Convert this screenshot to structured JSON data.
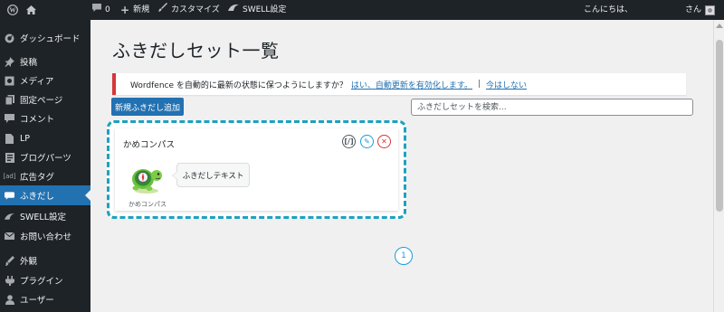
{
  "admin_bar": {
    "comments_count": "0",
    "new_label": "新規",
    "customize_label": "カスタマイズ",
    "swell_settings_label": "SWELL設定",
    "greeting": "こんにちは、",
    "greeting_suffix": "さん"
  },
  "sidebar": {
    "items": [
      {
        "label": "ダッシュボード",
        "icon": "dashboard-icon"
      },
      {
        "label": "投稿",
        "icon": "pin-icon"
      },
      {
        "label": "メディア",
        "icon": "media-icon"
      },
      {
        "label": "固定ページ",
        "icon": "page-icon"
      },
      {
        "label": "コメント",
        "icon": "comment-icon"
      },
      {
        "label": "LP",
        "icon": "lp-icon"
      },
      {
        "label": "ブログパーツ",
        "icon": "blog-parts-icon"
      },
      {
        "label": "広告タグ",
        "icon": "ad-tag-icon",
        "icon_text": "[ad]"
      },
      {
        "label": "ふきだし",
        "icon": "balloon-icon"
      },
      {
        "label": "SWELL設定",
        "icon": "swell-icon"
      },
      {
        "label": "お問い合わせ",
        "icon": "mail-icon"
      },
      {
        "label": "外観",
        "icon": "appearance-icon"
      },
      {
        "label": "プラグイン",
        "icon": "plugin-icon"
      },
      {
        "label": "ユーザー",
        "icon": "user-icon"
      }
    ]
  },
  "main": {
    "title": "ふきだしセット一覧",
    "notice": {
      "text": "Wordfence を自動的に最新の状態に保つようにしますか？",
      "link1": "はい、自動更新を有効化します。",
      "separator": "|",
      "link2": "今はしない"
    },
    "add_button": "新規ふきだし追加",
    "search": {
      "placeholder": "ふきだしセットを検索...",
      "value": ""
    },
    "card": {
      "title": "かめコンパス",
      "copy_label": "[/]",
      "edit_label": "✎",
      "delete_label": "✕",
      "character_name": "かめコンパス",
      "balloon_text": "ふきだしテキスト"
    },
    "pagination": {
      "current": "1"
    }
  },
  "colors": {
    "admin_dark": "#1d2327",
    "accent_blue": "#2271b1",
    "dashed_border": "#1ea1c0",
    "notice_red": "#d63638",
    "background": "#f0f0f1"
  }
}
